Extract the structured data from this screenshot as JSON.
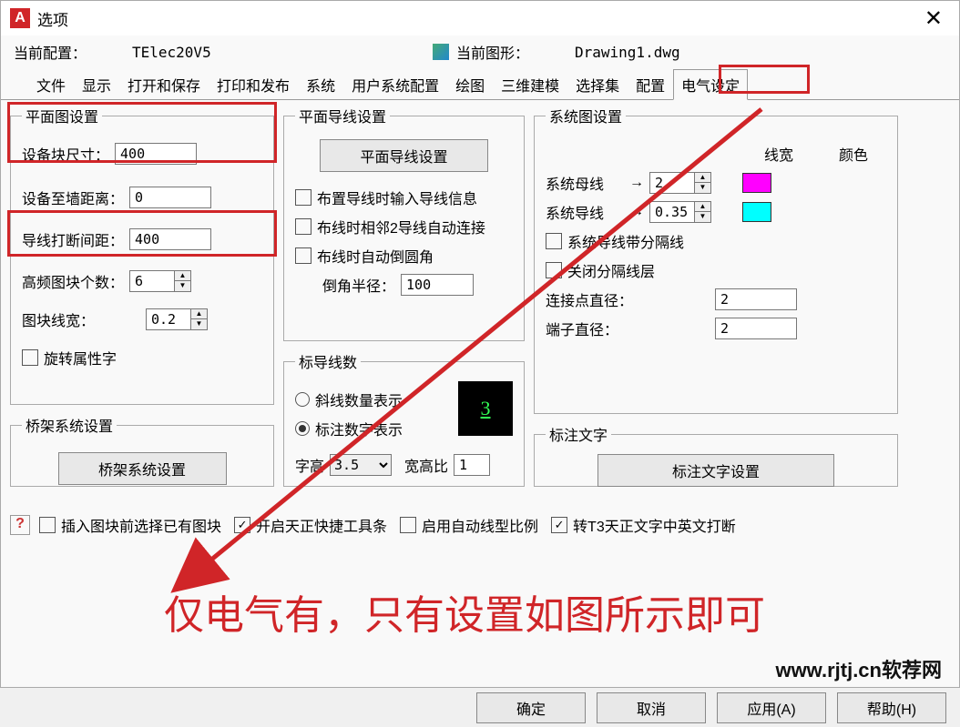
{
  "window": {
    "title": "选项"
  },
  "info": {
    "current_config_label": "当前配置：",
    "current_config_value": "TElec20V5",
    "current_drawing_label": "当前图形：",
    "current_drawing_value": "Drawing1.dwg"
  },
  "tabs": {
    "file": "文件",
    "display": "显示",
    "open_save": "打开和保存",
    "print_pub": "打印和发布",
    "system": "系统",
    "user_pref": "用户系统配置",
    "draw": "绘图",
    "model3d": "三维建模",
    "selection": "选择集",
    "config": "配置",
    "elec": "电气设定"
  },
  "plan": {
    "legend": "平面图设置",
    "block_size_label": "设备块尺寸：",
    "block_size": "400",
    "wall_dist_label": "设备至墙距离：",
    "wall_dist": "0",
    "break_dist_label": "导线打断间距：",
    "break_dist": "400",
    "freq_count_label": "高频图块个数：",
    "freq_count": "6",
    "block_lw_label": "图块线宽：",
    "block_lw": "0.2",
    "rotate_attr_label": "旋转属性字"
  },
  "bridge": {
    "legend": "桥架系统设置",
    "button": "桥架系统设置"
  },
  "wire": {
    "legend": "平面导线设置",
    "button": "平面导线设置",
    "chk1": "布置导线时输入导线信息",
    "chk2": "布线时相邻2导线自动连接",
    "chk3": "布线时自动倒圆角",
    "radius_label": "倒角半径：",
    "radius": "100"
  },
  "marker": {
    "legend": "标导线数",
    "opt1": "斜线数量表示",
    "opt2": "标注数字表示",
    "height_label": "字高",
    "height": "3.5",
    "ratio_label": "宽高比",
    "ratio": "1",
    "preview": "3"
  },
  "sys": {
    "legend": "系统图设置",
    "lw_header": "线宽",
    "color_header": "颜色",
    "bus_label": "系统母线",
    "bus_val": "2",
    "wire_label": "系统导线",
    "wire_val": "0.35",
    "chk_sep": "系统导线带分隔线",
    "chk_close": "关闭分隔线层",
    "conn_label": "连接点直径：",
    "conn_val": "2",
    "term_label": "端子直径：",
    "term_val": "2"
  },
  "label_text": {
    "legend": "标注文字",
    "button": "标注文字设置"
  },
  "footer_checks": {
    "c1": "插入图块前选择已有图块",
    "c2": "开启天正快捷工具条",
    "c3": "启用自动线型比例",
    "c4": "转T3天正文字中英文打断"
  },
  "buttons": {
    "ok": "确定",
    "cancel": "取消",
    "apply": "应用(A)",
    "help": "帮助(H)"
  },
  "annotation": "仅电气有，只有设置如图所示即可",
  "watermark": "www.rjtj.cn软荐网"
}
